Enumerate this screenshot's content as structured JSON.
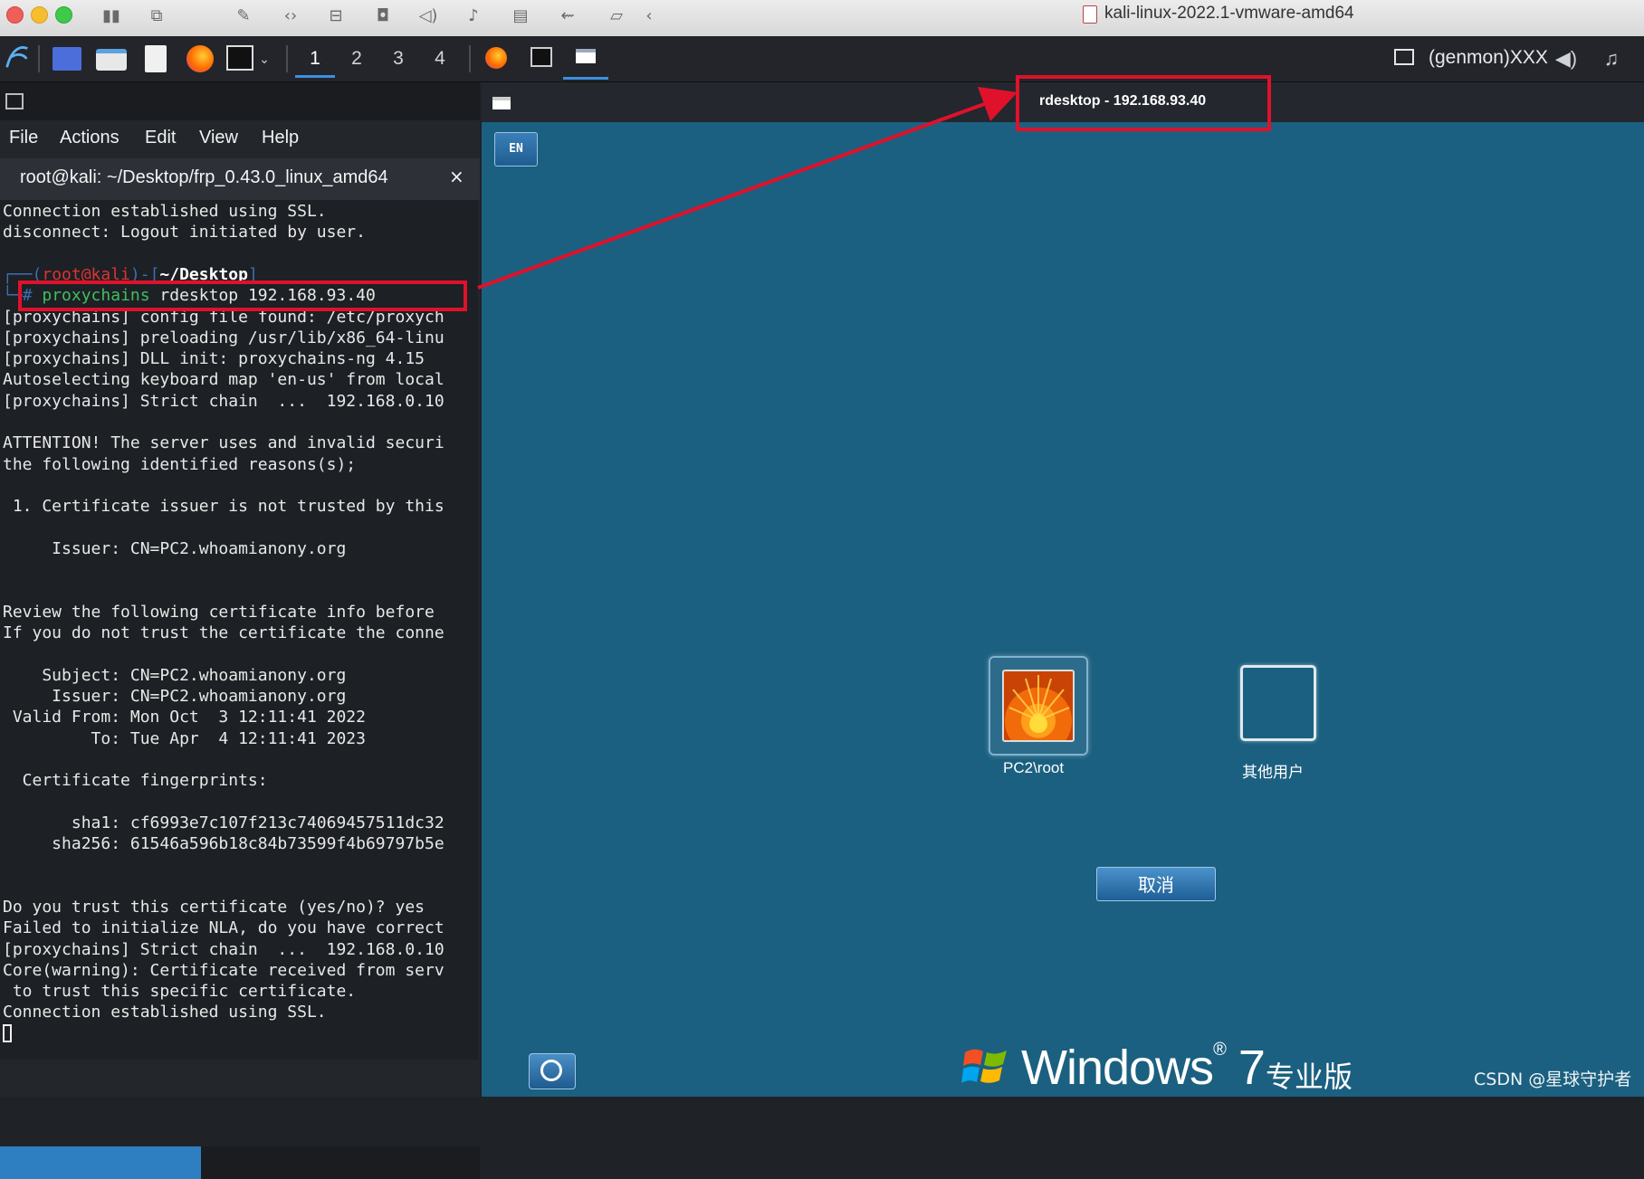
{
  "host": {
    "window_title": "kali-linux-2022.1-vmware-amd64"
  },
  "panel": {
    "workspaces": [
      "1",
      "2",
      "3",
      "4"
    ],
    "active_workspace": "1",
    "genmon": "(genmon)XXX"
  },
  "terminal": {
    "menu": [
      "File",
      "Actions",
      "Edit",
      "View",
      "Help"
    ],
    "tab_title": "root@kali: ~/Desktop/frp_0.43.0_linux_amd64",
    "tab_close": "×",
    "prompt_user": "root@kali",
    "prompt_dir": "~/Desktop",
    "command_prompt": "# ",
    "command_tool": "proxychains",
    "command_rest": " rdesktop 192.168.93.40",
    "lines_before": [
      "Connection established using SSL.",
      "disconnect: Logout initiated by user."
    ],
    "lines_after": [
      "[proxychains] config file found: /etc/proxych",
      "[proxychains] preloading /usr/lib/x86_64-linu",
      "[proxychains] DLL init: proxychains-ng 4.15",
      "Autoselecting keyboard map 'en-us' from local",
      "[proxychains] Strict chain  ...  192.168.0.10",
      "",
      "ATTENTION! The server uses and invalid securi",
      "the following identified reasons(s);",
      "",
      " 1. Certificate issuer is not trusted by this",
      "",
      "     Issuer: CN=PC2.whoamianony.org",
      "",
      "",
      "Review the following certificate info before",
      "If you do not trust the certificate the conne",
      "",
      "    Subject: CN=PC2.whoamianony.org",
      "     Issuer: CN=PC2.whoamianony.org",
      " Valid From: Mon Oct  3 12:11:41 2022",
      "         To: Tue Apr  4 12:11:41 2023",
      "",
      "  Certificate fingerprints:",
      "",
      "       sha1: cf6993e7c107f213c74069457511dc32",
      "     sha256: 61546a596b18c84b73599f4b69797b5e",
      "",
      "",
      "Do you trust this certificate (yes/no)? yes",
      "Failed to initialize NLA, do you have correct",
      "[proxychains] Strict chain  ...  192.168.0.10",
      "Core(warning): Certificate received from serv",
      " to trust this specific certificate.",
      "Connection established using SSL."
    ]
  },
  "rdesktop": {
    "title": "rdesktop - 192.168.93.40",
    "lang_indicator": "EN",
    "users": [
      {
        "label": "PC2\\root"
      },
      {
        "label": "其他用户"
      }
    ],
    "cancel_label": "取消",
    "windows_brand": "Windows",
    "windows_version": "7",
    "windows_edition": "专业版"
  },
  "watermark": "CSDN @星球守护者",
  "colors": {
    "highlight": "#e0112b",
    "login_bg": "#1b6080",
    "terminal_bg": "#1d2024",
    "accent": "#3d8fe0"
  }
}
